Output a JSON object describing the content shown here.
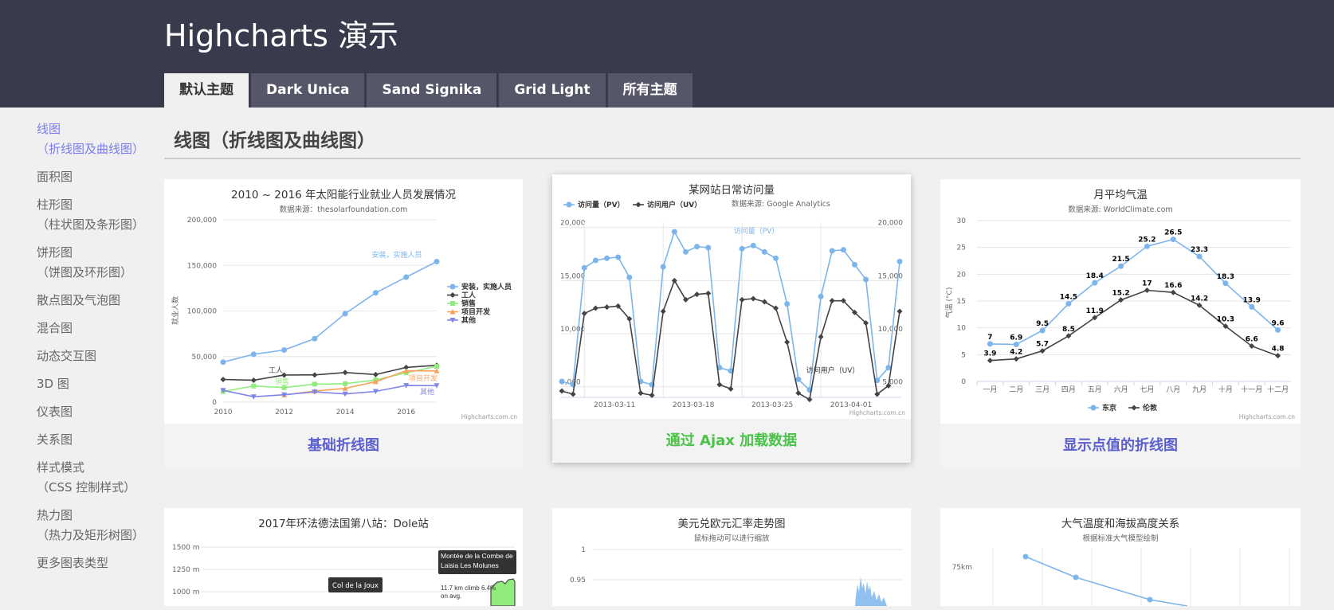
{
  "header": {
    "title": "Highcharts 演示"
  },
  "tabs": [
    {
      "label": "默认主题",
      "active": true
    },
    {
      "label": "Dark Unica"
    },
    {
      "label": "Sand Signika"
    },
    {
      "label": "Grid Light"
    },
    {
      "label": "所有主题"
    }
  ],
  "sidebar": {
    "items": [
      {
        "label": "线图",
        "sub": "（折线图及曲线图）",
        "active": true
      },
      {
        "label": "面积图"
      },
      {
        "label": "柱形图",
        "sub": "（柱状图及条形图）"
      },
      {
        "label": "饼形图",
        "sub": "（饼图及环形图）"
      },
      {
        "label": "散点图及气泡图"
      },
      {
        "label": "混合图"
      },
      {
        "label": "动态交互图"
      },
      {
        "label": "3D 图"
      },
      {
        "label": "仪表图"
      },
      {
        "label": "关系图"
      },
      {
        "label": "样式模式",
        "sub": "（CSS 控制样式）"
      },
      {
        "label": "热力图",
        "sub": "（热力及矩形树图）"
      },
      {
        "label": "更多图表类型"
      }
    ]
  },
  "main": {
    "section_title": "线图（折线图及曲线图）",
    "cards": [
      {
        "caption": "基础折线图"
      },
      {
        "caption": "通过 Ajax 加载数据"
      },
      {
        "caption": "显示点值的折线图"
      }
    ],
    "lower_titles": [
      "2017年环法德法国第八站：Dole站",
      "美元兑欧元汇率走势图",
      "大气温度和海拔高度关系"
    ],
    "lower_subtitles": [
      "",
      "鼠标拖动可以进行缩放",
      "根据标准大气模型绘制"
    ]
  },
  "colors": {
    "blue": "#7cb5ec",
    "black": "#434348",
    "green": "#90ed7d",
    "orange": "#f7a35c",
    "purple": "#8085e9",
    "header_bg": "#393a4c"
  },
  "chart_data": [
    {
      "type": "line",
      "title": "2010 ~ 2016 年太阳能行业就业人员发展情况",
      "subtitle": "数据来源：thesolarfoundation.com",
      "ylabel": "就业人数",
      "credit": "Highcharts.com.cn",
      "x": [
        2010,
        2011,
        2012,
        2013,
        2014,
        2015,
        2016,
        2017
      ],
      "xticks": [
        "2010",
        "2012",
        "2014",
        "2016"
      ],
      "yticks": [
        "0",
        "50,000",
        "100,000",
        "150,000",
        "200,000"
      ],
      "ylim": [
        0,
        200000
      ],
      "series": [
        {
          "name": "安装，实施人员",
          "values": [
            43934,
            52503,
            57177,
            69658,
            97031,
            119931,
            137133,
            154175
          ]
        },
        {
          "name": "工人",
          "values": [
            24916,
            24064,
            29742,
            29851,
            32490,
            30282,
            38121,
            40434
          ]
        },
        {
          "name": "销售",
          "values": [
            11744,
            17722,
            16005,
            19771,
            20185,
            24377,
            32147,
            39387
          ]
        },
        {
          "name": "项目开发",
          "values": [
            null,
            null,
            7988,
            12169,
            15112,
            22452,
            34400,
            34227
          ]
        },
        {
          "name": "其他",
          "values": [
            12908,
            5948,
            8105,
            11248,
            8989,
            11816,
            18274,
            18111
          ]
        }
      ],
      "annotations": [
        "安装，实施人员",
        "工人",
        "销售",
        "项目开发",
        "其他"
      ]
    },
    {
      "type": "line",
      "title": "某网站日常访问量",
      "subtitle": "数据来源: Google Analytics",
      "credit": "Highcharts.com.cn",
      "xticks": [
        "2013-03-11",
        "2013-03-18",
        "2013-03-25",
        "2013-04-01"
      ],
      "yticks": [
        "5,000",
        "10,000",
        "15,000",
        "20,000"
      ],
      "ylim": [
        4000,
        20500
      ],
      "series": [
        {
          "name": "访问量（PV）",
          "values": [
            5500,
            5200,
            16200,
            16900,
            17100,
            17200,
            15300,
            5500,
            5200,
            16300,
            19600,
            17700,
            18200,
            18100,
            6800,
            6500,
            18000,
            18300,
            17700,
            17100,
            12800,
            5700,
            4700,
            13500,
            17800,
            17900,
            16500,
            15100,
            5600,
            6800,
            16800
          ]
        },
        {
          "name": "访问用户（UV）",
          "values": [
            4600,
            4300,
            11900,
            12400,
            12500,
            12600,
            11400,
            4400,
            4200,
            12100,
            15000,
            13200,
            13700,
            13800,
            5200,
            4800,
            13200,
            13300,
            13000,
            12400,
            9200,
            4400,
            3800,
            9700,
            13100,
            13100,
            12000,
            11000,
            4300,
            5100,
            12100
          ]
        }
      ],
      "annotations": [
        "访问量（PV）",
        "访问用户（UV）"
      ]
    },
    {
      "type": "line",
      "title": "月平均气温",
      "subtitle": "数据来源: WorldClimate.com",
      "ylabel": "气温 (°C)",
      "credit": "Highcharts.com.cn",
      "categories": [
        "一月",
        "二月",
        "三月",
        "四月",
        "五月",
        "六月",
        "七月",
        "八月",
        "九月",
        "十月",
        "十一月",
        "十二月"
      ],
      "yticks": [
        "0",
        "5",
        "10",
        "15",
        "20",
        "25",
        "30"
      ],
      "ylim": [
        0,
        30
      ],
      "series": [
        {
          "name": "东京",
          "values": [
            7.0,
            6.9,
            9.5,
            14.5,
            18.4,
            21.5,
            25.2,
            26.5,
            23.3,
            18.3,
            13.9,
            9.6
          ]
        },
        {
          "name": "伦敦",
          "values": [
            3.9,
            4.2,
            5.7,
            8.5,
            11.9,
            15.2,
            17.0,
            16.6,
            14.2,
            10.3,
            6.6,
            4.8
          ]
        }
      ]
    }
  ],
  "lower_chart_bits": {
    "dole": {
      "yticks": [
        "1500 m",
        "1250 m",
        "1000 m"
      ],
      "flags": [
        "Col de la Joux",
        "Montée de la Combe de Laisia Les Molunes"
      ],
      "note": "11.7 km climb 6.4% on avg."
    },
    "fx": {
      "yticks": [
        "1",
        "0.95"
      ]
    },
    "atm": {
      "yticks": [
        "75km"
      ]
    }
  }
}
